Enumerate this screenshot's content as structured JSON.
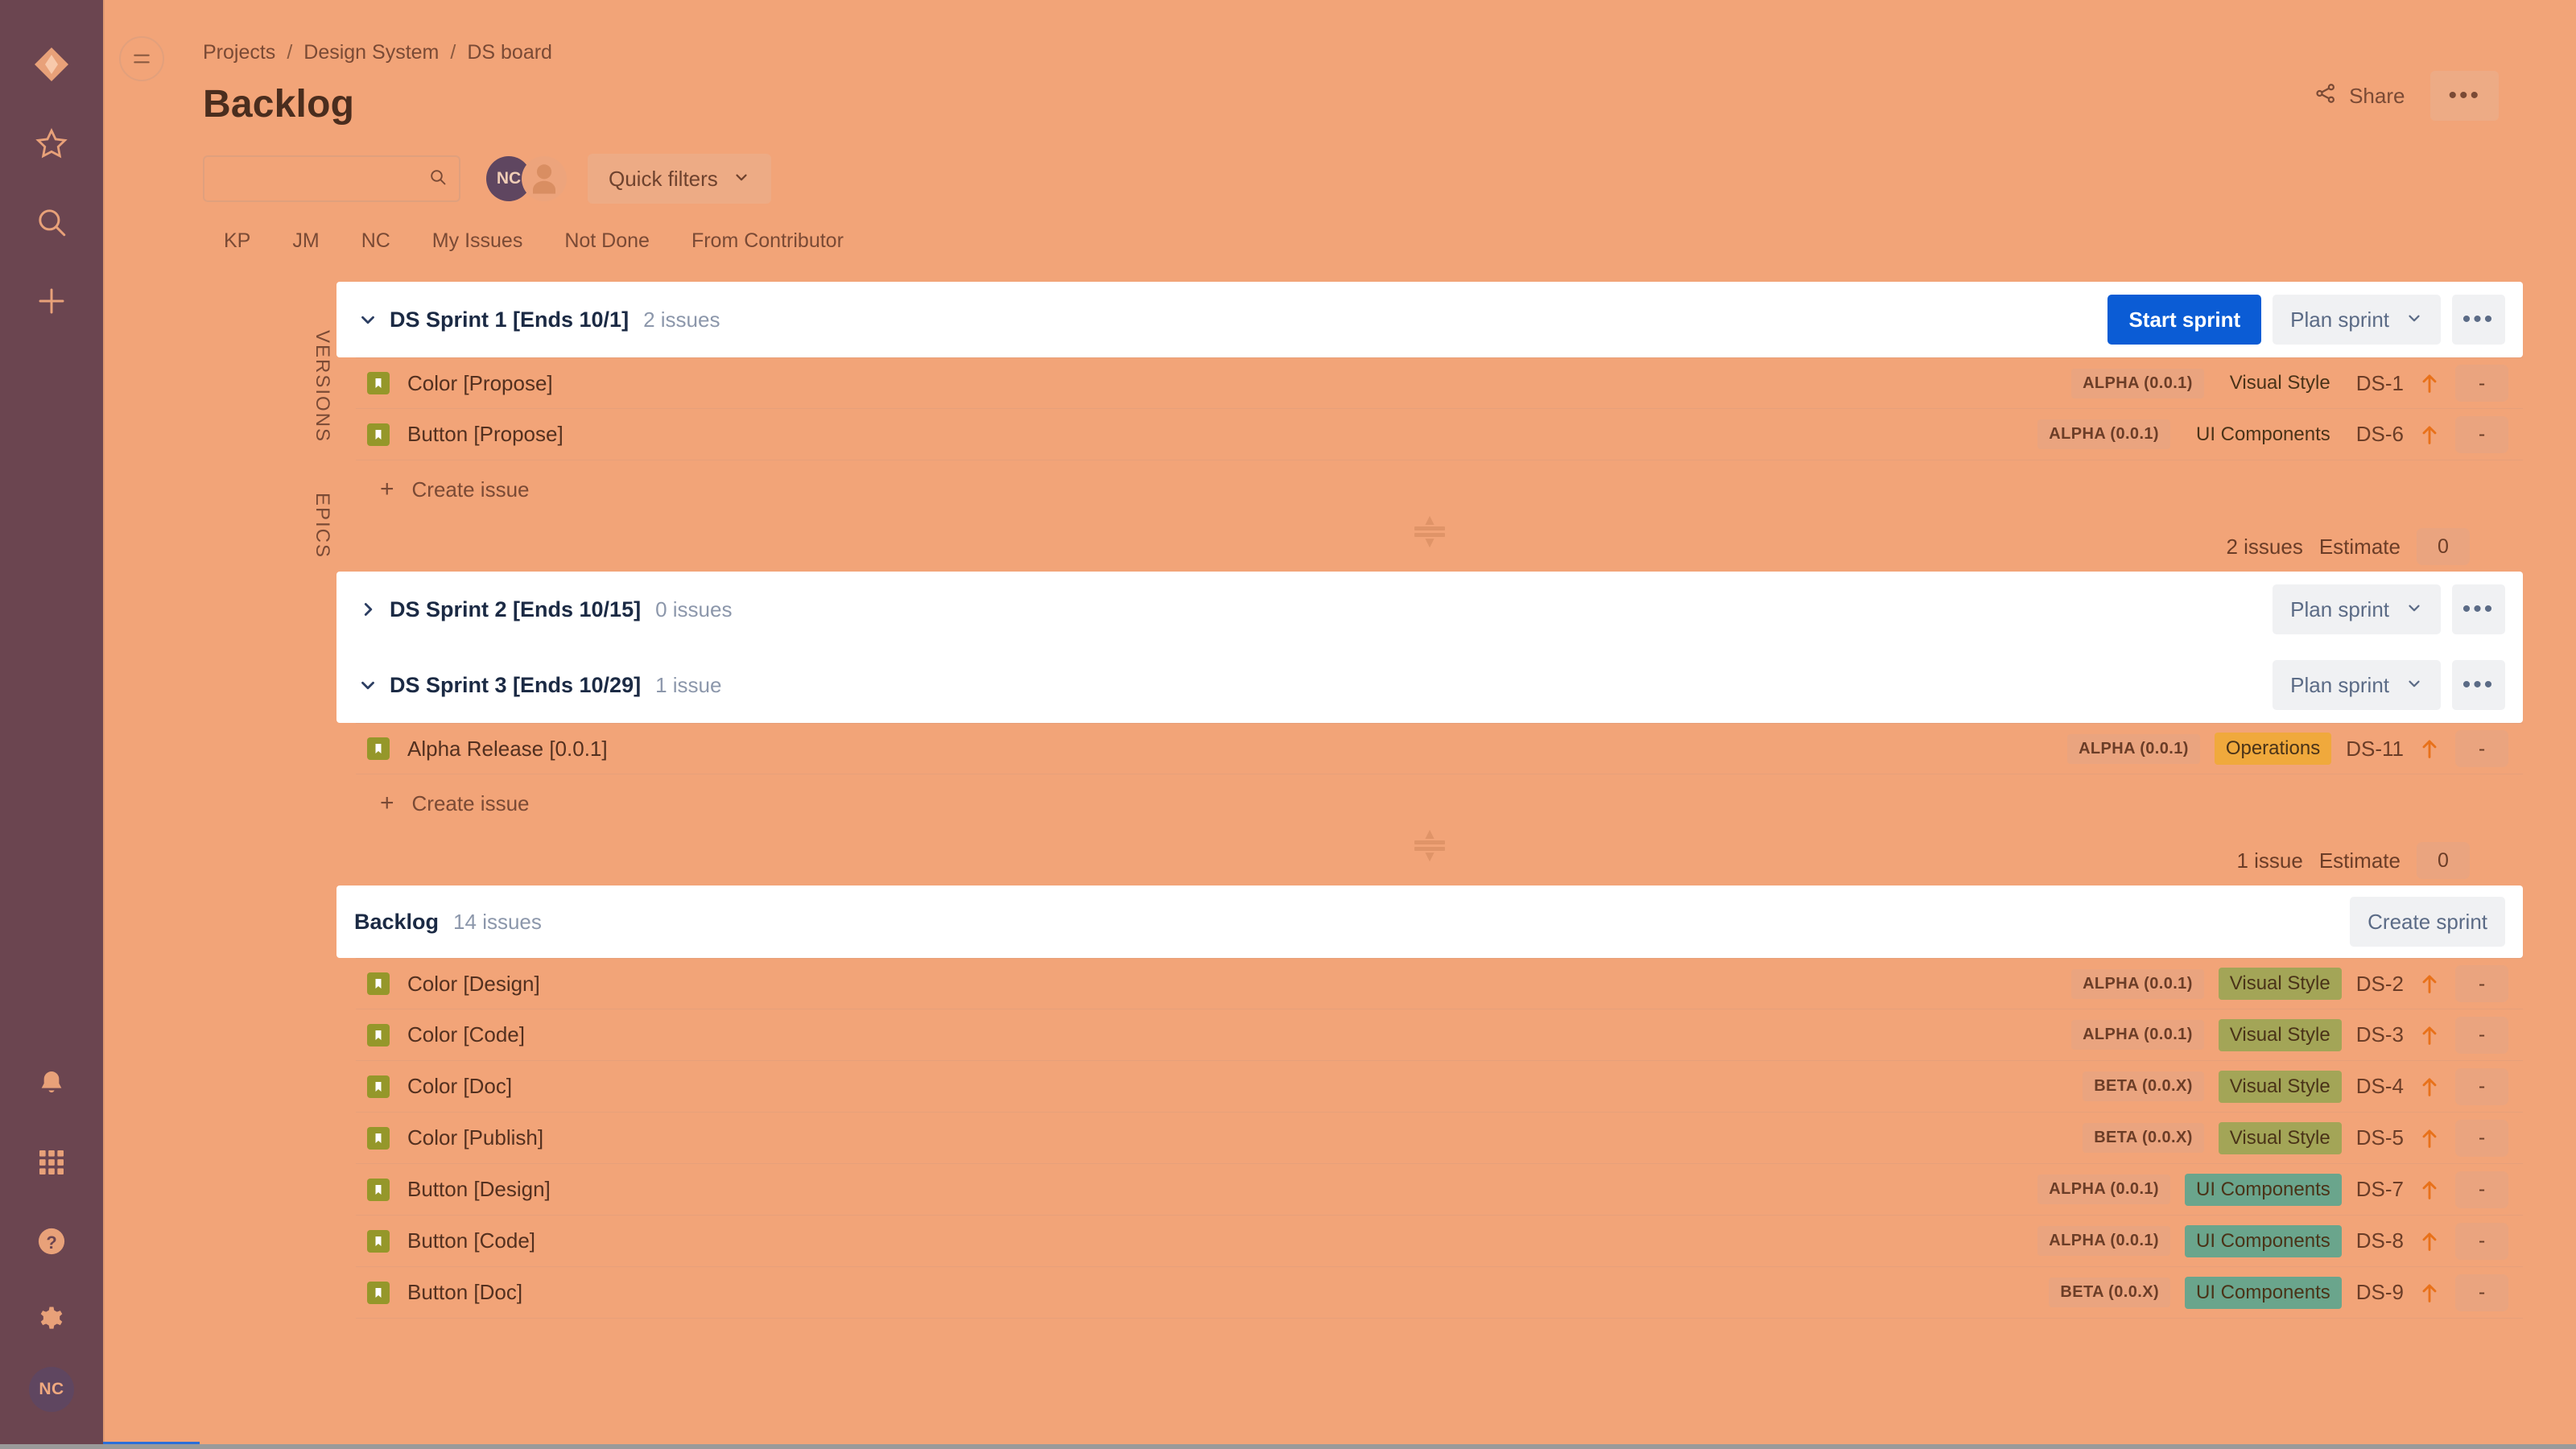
{
  "rail": {
    "logo_icon": "jira-logo-icon",
    "top_items": [
      {
        "icon": "star-icon",
        "name": "starred"
      },
      {
        "icon": "search-icon",
        "name": "search"
      },
      {
        "icon": "plus-icon",
        "name": "create"
      }
    ],
    "bottom_items": [
      {
        "icon": "bell-icon",
        "name": "notifications"
      },
      {
        "icon": "grid-apps-icon",
        "name": "app-switcher"
      },
      {
        "icon": "help-icon",
        "name": "help"
      },
      {
        "icon": "gear-icon",
        "name": "settings"
      }
    ],
    "avatar_initials": "NC"
  },
  "header": {
    "breadcrumb": [
      "Projects",
      "Design System",
      "DS board"
    ],
    "breadcrumb_separator": "/",
    "title": "Backlog",
    "share_label": "Share",
    "share_icon": "share-icon",
    "more_label": "•••",
    "more_icon": "more-options-icon"
  },
  "filters": {
    "search_placeholder": "",
    "search_value": "",
    "search_icon": "search-icon",
    "avatars": [
      {
        "initials": "NC",
        "name": "avatar-nc"
      },
      {
        "initials": "",
        "name": "avatar-anonymous"
      }
    ],
    "quick_filters_label": "Quick filters",
    "quick_filters_caret": "chevron-down-icon",
    "chips": [
      "KP",
      "JM",
      "NC",
      "My Issues",
      "Not Done",
      "From Contributor"
    ]
  },
  "side_strip": {
    "versions_label": "VERSIONS",
    "epics_label": "EPICS"
  },
  "board": {
    "sprints": [
      {
        "name": "DS Sprint 1 [Ends 10/1]",
        "count_label": "2 issues",
        "expanded": true,
        "caret": "chevron-down-icon",
        "start_sprint_label": "Start sprint",
        "plan_sprint_label": "Plan sprint",
        "plan_sprint_caret": "chevron-down-icon",
        "more_label": "•••",
        "issues": [
          {
            "icon": "story-icon",
            "title": "Color [Propose]",
            "version": "ALPHA (0.0.1)",
            "epic": "Visual Style",
            "epic_color": "#a3a557",
            "key": "DS-1",
            "priority_icon": "priority-high-icon",
            "estimate": "-"
          },
          {
            "icon": "story-icon",
            "title": "Button [Propose]",
            "version": "ALPHA (0.0.1)",
            "epic": "UI Components",
            "epic_color": "#6aa58c",
            "key": "DS-6",
            "priority_icon": "priority-high-icon",
            "estimate": "-"
          }
        ],
        "create_issue_label": "Create issue",
        "footer": {
          "issues_label": "2 issues",
          "estimate_label": "Estimate",
          "estimate_value": "0"
        }
      },
      {
        "name": "DS Sprint 2 [Ends 10/15]",
        "count_label": "0 issues",
        "expanded": false,
        "caret": "chevron-right-icon",
        "plan_sprint_label": "Plan sprint",
        "plan_sprint_caret": "chevron-down-icon",
        "more_label": "•••",
        "issues": [],
        "footer": null
      },
      {
        "name": "DS Sprint 3 [Ends 10/29]",
        "count_label": "1 issue",
        "expanded": true,
        "caret": "chevron-down-icon",
        "plan_sprint_label": "Plan sprint",
        "plan_sprint_caret": "chevron-down-icon",
        "more_label": "•••",
        "issues": [
          {
            "icon": "story-icon",
            "title": "Alpha Release [0.0.1]",
            "version": "ALPHA (0.0.1)",
            "epic": "Operations",
            "epic_color": "#f0a93c",
            "key": "DS-11",
            "priority_icon": "priority-high-icon",
            "estimate": "-"
          }
        ],
        "create_issue_label": "Create issue",
        "footer": {
          "issues_label": "1 issue",
          "estimate_label": "Estimate",
          "estimate_value": "0"
        }
      }
    ],
    "backlog": {
      "title": "Backlog",
      "count_label": "14 issues",
      "create_sprint_label": "Create sprint",
      "issues": [
        {
          "icon": "story-icon",
          "title": "Color [Design]",
          "version": "ALPHA (0.0.1)",
          "epic": "Visual Style",
          "epic_color": "#a3a557",
          "key": "DS-2",
          "priority_icon": "priority-high-icon",
          "estimate": "-"
        },
        {
          "icon": "story-icon",
          "title": "Color [Code]",
          "version": "ALPHA (0.0.1)",
          "epic": "Visual Style",
          "epic_color": "#a3a557",
          "key": "DS-3",
          "priority_icon": "priority-high-icon",
          "estimate": "-"
        },
        {
          "icon": "story-icon",
          "title": "Color [Doc]",
          "version": "BETA (0.0.X)",
          "epic": "Visual Style",
          "epic_color": "#a3a557",
          "key": "DS-4",
          "priority_icon": "priority-high-icon",
          "estimate": "-"
        },
        {
          "icon": "story-icon",
          "title": "Color [Publish]",
          "version": "BETA (0.0.X)",
          "epic": "Visual Style",
          "epic_color": "#a3a557",
          "key": "DS-5",
          "priority_icon": "priority-high-icon",
          "estimate": "-"
        },
        {
          "icon": "story-icon",
          "title": "Button [Design]",
          "version": "ALPHA (0.0.1)",
          "epic": "UI Components",
          "epic_color": "#6aa58c",
          "key": "DS-7",
          "priority_icon": "priority-high-icon",
          "estimate": "-"
        },
        {
          "icon": "story-icon",
          "title": "Button [Code]",
          "version": "ALPHA (0.0.1)",
          "epic": "UI Components",
          "epic_color": "#6aa58c",
          "key": "DS-8",
          "priority_icon": "priority-high-icon",
          "estimate": "-"
        },
        {
          "icon": "story-icon",
          "title": "Button [Doc]",
          "version": "BETA (0.0.X)",
          "epic": "UI Components",
          "epic_color": "#6aa58c",
          "key": "DS-9",
          "priority_icon": "priority-high-icon",
          "estimate": "-"
        }
      ]
    }
  },
  "colors": {
    "page_bg": "#f2a478",
    "rail_bg": "#6b4550",
    "card_bg": "#ffffff",
    "primary_button": "#0b5cd5",
    "story_icon": "#95972a",
    "epic_visual_style": "#a3a557",
    "epic_ui_components": "#6aa58c",
    "epic_operations": "#f0a93c",
    "priority_high": "#e8711a"
  }
}
